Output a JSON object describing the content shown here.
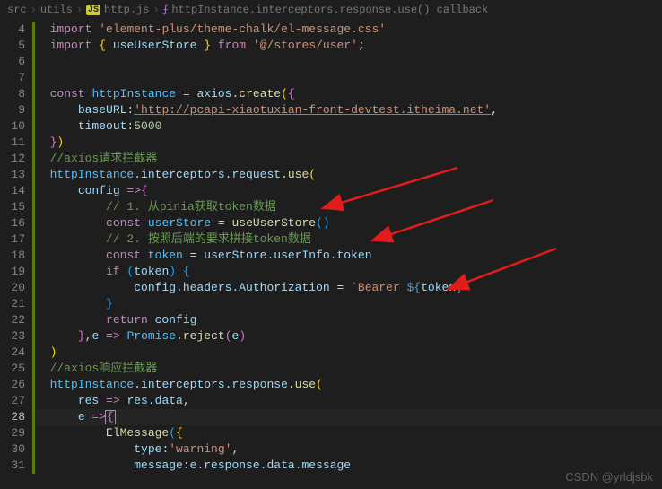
{
  "breadcrumb": {
    "folders": [
      "src",
      "utils"
    ],
    "file": "http.js",
    "symbol": "httpInstance.interceptors.response.use() callback"
  },
  "editor": {
    "first_line": 4,
    "active_line": 28
  },
  "watermark": "CSDN @yrldjsbk",
  "code": {
    "l4": {
      "kw1": "import",
      "str": "'element-plus/theme-chalk/el-message.css'"
    },
    "l5": {
      "kw1": "import",
      "br": "{ ",
      "id": "useUserStore",
      "br2": " }",
      "kw2": "from",
      "str": "'@/stores/user'",
      "semi": ";"
    },
    "l8": {
      "kw": "const",
      "var": "httpInstance",
      "eq": " = ",
      "obj": "axios",
      "dot": ".",
      "fn": "create",
      "open": "(",
      "brace": "{"
    },
    "l9": {
      "prop": "baseURL",
      "colon": ":",
      "str": "'http://pcapi-xiaotuxian-front-devtest.itheima.net'",
      "comma": ","
    },
    "l10": {
      "prop": "timeout",
      "colon": ":",
      "num": "5000"
    },
    "l11": {
      "close": "})"
    },
    "l12": {
      "com": "//axios请求拦截器"
    },
    "l13": {
      "obj": "httpInstance",
      "p1": ".interceptors",
      "p2": ".request",
      "fn": ".use",
      "open": "("
    },
    "l14": {
      "param": "config",
      "arrow": " =>",
      "brace": "{"
    },
    "l15": {
      "com": "// 1. 从pinia获取token数据"
    },
    "l16": {
      "kw": "const",
      "var": "userStore",
      "eq": " = ",
      "fn": "useUserStore",
      "paren": "()"
    },
    "l17": {
      "com": "// 2. 按照后端的要求拼接token数据"
    },
    "l18": {
      "kw": "const",
      "var": "token",
      "eq": " = ",
      "obj": "userStore",
      "p1": ".userInfo",
      "p2": ".token"
    },
    "l19": {
      "kw": "if",
      "open": " (",
      "var": "token",
      "close": ") ",
      "brace": "{"
    },
    "l20": {
      "obj": "config",
      "p1": ".headers",
      "p2": ".Authorization",
      "eq": " = ",
      "tpl_open": "`",
      "str": "Bearer ",
      "dollar": "${",
      "var": "token",
      "dollar_close": "}",
      "tpl_close": "`"
    },
    "l21": {
      "close": "}"
    },
    "l22": {
      "kw": "return",
      "var": " config"
    },
    "l23": {
      "close": "}",
      "comma": ",",
      "param": "e",
      "arrow": " => ",
      "obj": "Promise",
      "fn": ".reject",
      "open": "(",
      "var2": "e",
      "close2": ")"
    },
    "l24": {
      "close": ")"
    },
    "l25": {
      "com": "//axios响应拦截器"
    },
    "l26": {
      "obj": "httpInstance",
      "p1": ".interceptors",
      "p2": ".response",
      "fn": ".use",
      "open": "("
    },
    "l27": {
      "param": "res",
      "arrow": " => ",
      "obj": "res",
      "p1": ".data",
      "comma": ","
    },
    "l28": {
      "param": "e",
      "arrow": " =>",
      "brace": "{"
    },
    "l29": {
      "fn": "ElMessage",
      "open": "(",
      "brace": "{"
    },
    "l30": {
      "prop": "type",
      "colon": ":",
      "str": "'warning'",
      "comma": ","
    },
    "l31": {
      "prop": "message",
      "colon": ":",
      "obj": "e",
      "p1": ".response",
      "p2": ".data",
      "p3": ".message"
    }
  }
}
